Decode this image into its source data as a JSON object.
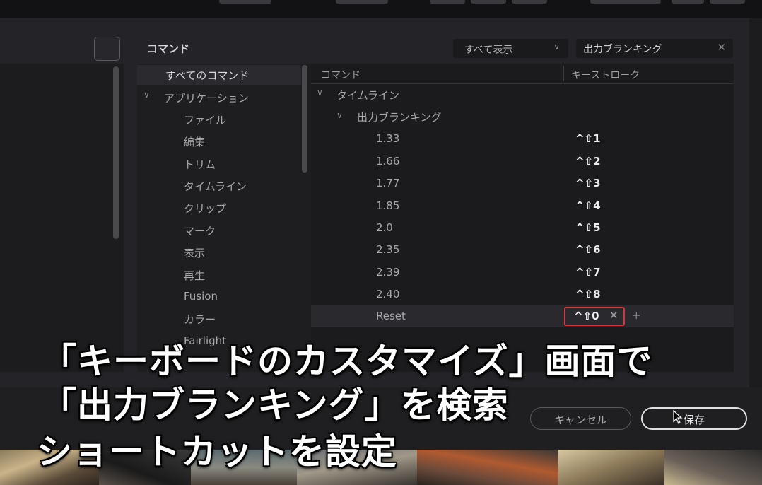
{
  "dialog": {
    "commands_title": "コマンド",
    "filter_select": "すべて表示",
    "search_value": "出力ブランキング"
  },
  "categories": [
    {
      "label": "すべてのコマンド",
      "selected": true
    },
    {
      "label": "アプリケーション",
      "expanded": true
    },
    {
      "label": "ファイル"
    },
    {
      "label": "編集"
    },
    {
      "label": "トリム"
    },
    {
      "label": "タイムライン"
    },
    {
      "label": "クリップ"
    },
    {
      "label": "マーク"
    },
    {
      "label": "表示"
    },
    {
      "label": "再生"
    },
    {
      "label": "Fusion"
    },
    {
      "label": "カラー"
    },
    {
      "label": "Fairlight"
    }
  ],
  "table": {
    "col_command": "コマンド",
    "col_keystroke": "キーストローク",
    "group": "タイムライン",
    "subgroup": "出力ブランキング",
    "rows": [
      {
        "command": "1.33",
        "key": "^⇧1"
      },
      {
        "command": "1.66",
        "key": "^⇧2"
      },
      {
        "command": "1.77",
        "key": "^⇧3"
      },
      {
        "command": "1.85",
        "key": "^⇧4"
      },
      {
        "command": "2.0",
        "key": "^⇧5"
      },
      {
        "command": "2.35",
        "key": "^⇧6"
      },
      {
        "command": "2.39",
        "key": "^⇧7"
      },
      {
        "command": "2.40",
        "key": "^⇧8"
      },
      {
        "command": "Reset",
        "key": "^⇧0"
      }
    ]
  },
  "footer": {
    "cancel": "キャンセル",
    "save": "保存"
  },
  "caption": {
    "line1": "「キーボードのカスタマイズ」画面で",
    "line2": "「出力ブランキング」を検索",
    "line3": "ショートカットを設定"
  },
  "colors": {
    "edit_border": "#d2373a",
    "background": "#242428"
  }
}
